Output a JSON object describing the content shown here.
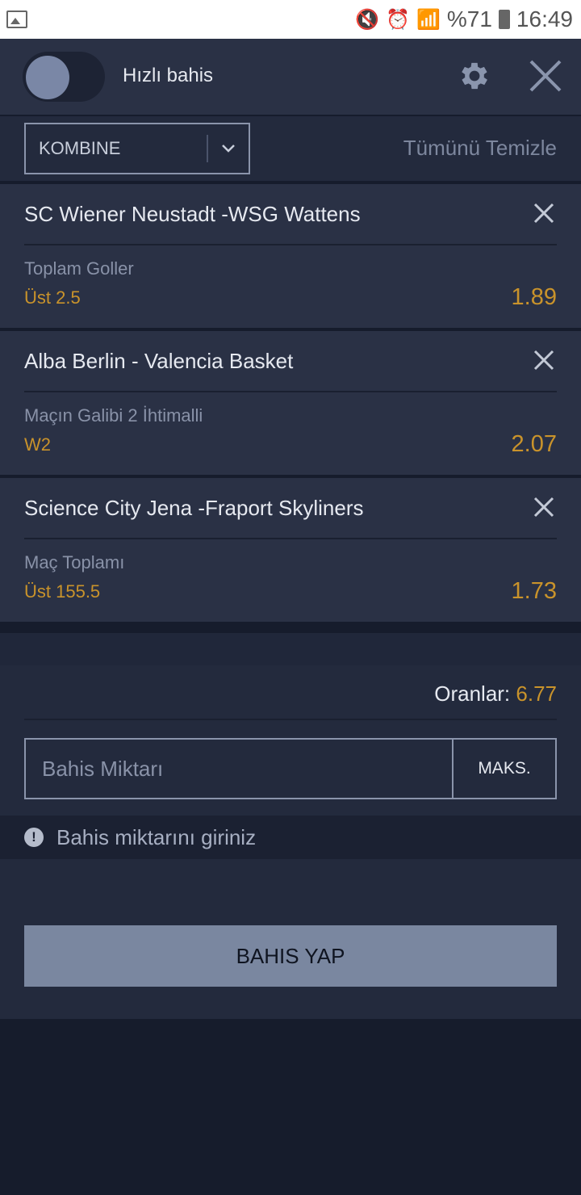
{
  "status_bar": {
    "battery": "%71",
    "time": "16:49"
  },
  "header": {
    "quick_bet_label": "Hızlı bahis",
    "quick_bet_enabled": false
  },
  "filter": {
    "bet_type": "KOMBINE",
    "clear_all": "Tümünü Temizle"
  },
  "bets": [
    {
      "event": "SC Wiener Neustadt -WSG Wattens",
      "market": "Toplam Goller",
      "outcome": "Üst 2.5",
      "odds": "1.89"
    },
    {
      "event": "Alba Berlin - Valencia Basket",
      "market": "Maçın Galibi 2 İhtimalli",
      "outcome": "W2",
      "odds": "2.07"
    },
    {
      "event": "Science City Jena -Fraport Skyliners",
      "market": "Maç Toplamı",
      "outcome": "Üst 155.5",
      "odds": "1.73"
    }
  ],
  "summary": {
    "odds_label": "Oranlar:",
    "odds_value": "6.77",
    "stake_placeholder": "Bahis Miktarı",
    "max_label": "MAKS."
  },
  "warning": {
    "text": "Bahis miktarını giriniz"
  },
  "place_bet": {
    "label": "BAHIS YAP"
  },
  "colors": {
    "accent_gold": "#c9932b",
    "panel": "#2a3145",
    "background": "#161c2c",
    "button": "#7a87a0"
  }
}
